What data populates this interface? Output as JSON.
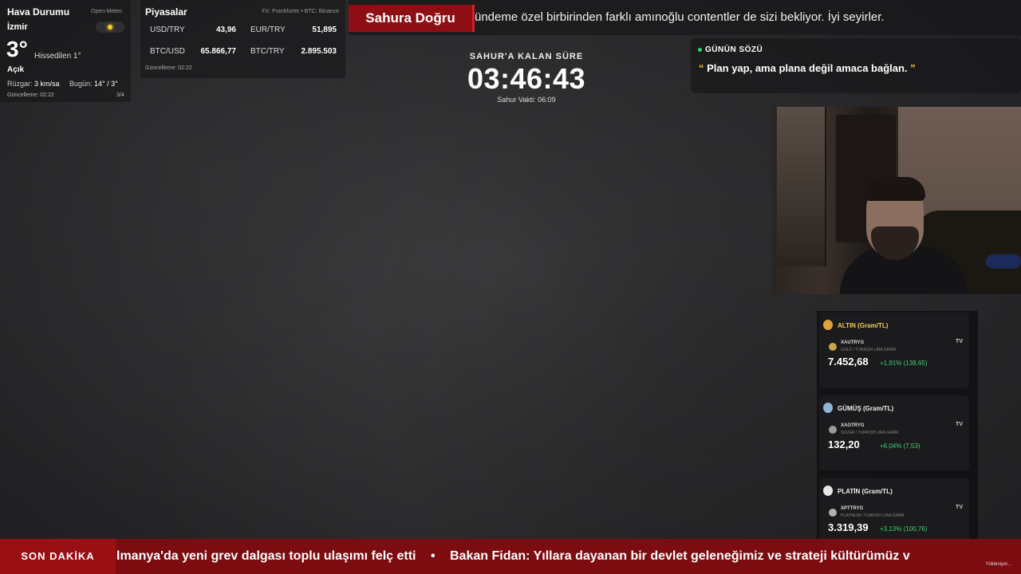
{
  "weather": {
    "title": "Hava Durumu",
    "source": "Open-Meteo",
    "city": "İzmir",
    "temp": "3°",
    "feels_like": "Hissedilen 1°",
    "condition": "Açık",
    "wind_label": "Rüzgar:",
    "wind_value": "3 km/sa",
    "today_label": "Bugün:",
    "today_value": "14° / 3°",
    "update": "Güncelleme: 02:22",
    "page": "3/4"
  },
  "markets": {
    "title": "Piyasalar",
    "source": "FX: Frankfurter • BTC: Binance",
    "items": [
      {
        "label": "USD/TRY",
        "value": "43,96"
      },
      {
        "label": "EUR/TRY",
        "value": "51,895"
      },
      {
        "label": "BTC/USD",
        "value": "65.866,77"
      },
      {
        "label": "BTC/TRY",
        "value": "2.895.503"
      }
    ],
    "update": "Güncelleme: 02:22"
  },
  "top_ticker": {
    "label": "Sahura Doğru",
    "text": "ündeme özel birbirinden farklı amınoğlu contentler de sizi bekliyor. İyi seyirler."
  },
  "countdown": {
    "label": "SAHUR'A KALAN SÜRE",
    "time": "03:46:43",
    "sahur_time": "Sahur Vakti: 06:09"
  },
  "quote": {
    "title": "GÜNÜN SÖZÜ",
    "open_mark": "“",
    "text": "Plan yap, ama plana değil amaca bağlan.",
    "close_mark": "”"
  },
  "commodities": [
    {
      "name": "ALTIN (Gram/TL)",
      "symbol": "XAUTRYG",
      "desc": "GOLD / TURKISH LIRA GRAM",
      "price": "7.452,68",
      "change": "+1,91% (139,65)",
      "medal_color": "#e0a23a",
      "tv": "TV"
    },
    {
      "name": "GÜMÜŞ (Gram/TL)",
      "symbol": "XAGTRYG",
      "desc": "SILVER / TURKISH LIRA GRAM",
      "price": "132,20",
      "change": "+6,04% (7,53)",
      "medal_color": "#8fb4d8",
      "tv": "TV"
    },
    {
      "name": "PLATİN (Gram/TL)",
      "symbol": "XPTTRYG",
      "desc": "PLATINUM / TURKISH LIRA GRAM",
      "price": "3.319,39",
      "change": "+3,13% (100,76)",
      "medal_color": "#e6e6e6",
      "tv": "TV"
    }
  ],
  "bottom_ticker": {
    "label": "SON DAKİKA",
    "item1": "lmanya'da yeni grev dalgası toplu ulaşımı felç etti",
    "separator": "•",
    "item2": "Bakan Fidan: Yıllara dayanan bir devlet geleneğimiz ve strateji kültürümüz v",
    "loading": "Yükleniyor..."
  }
}
